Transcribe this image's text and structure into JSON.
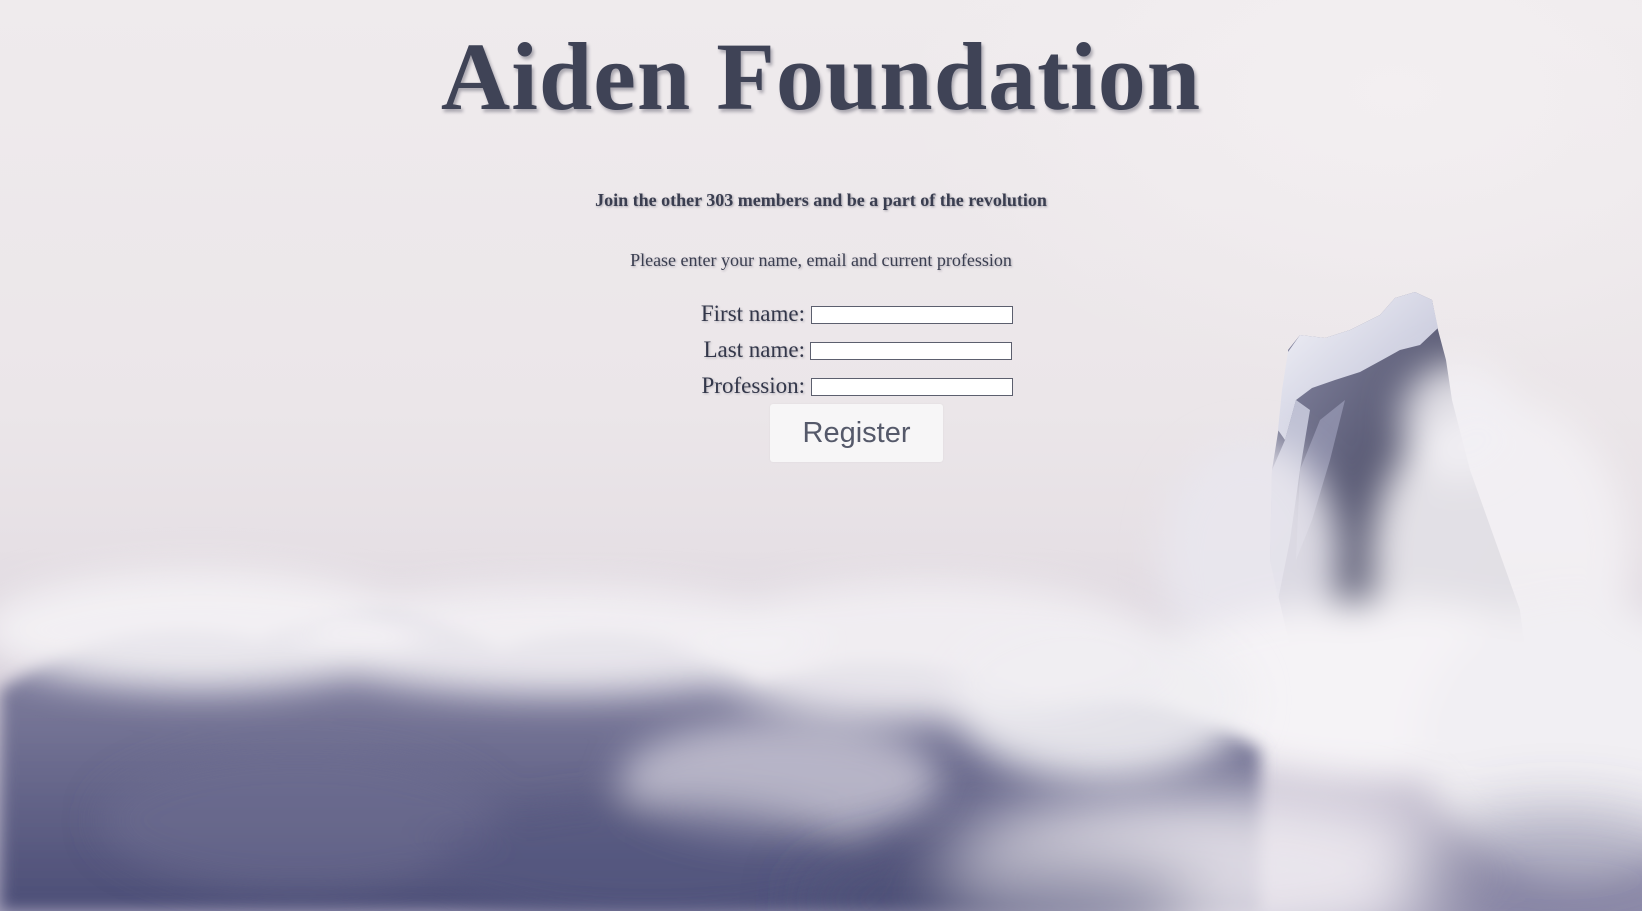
{
  "page": {
    "title": "Aiden Foundation",
    "subtitle": "Join the other 303 members and be a part of the revolution",
    "instructions": "Please enter your name, email and current profession"
  },
  "form": {
    "first_name_label": "First name:",
    "first_name_value": "",
    "last_name_label": "Last name:",
    "last_name_value": "",
    "profession_label": "Profession:",
    "profession_value": "",
    "register_label": "Register"
  },
  "colors": {
    "text": "#3f4356",
    "sky": "#ece8ea",
    "cloud_shadow": "#4f5178",
    "button_bg": "#f7f6f7"
  }
}
